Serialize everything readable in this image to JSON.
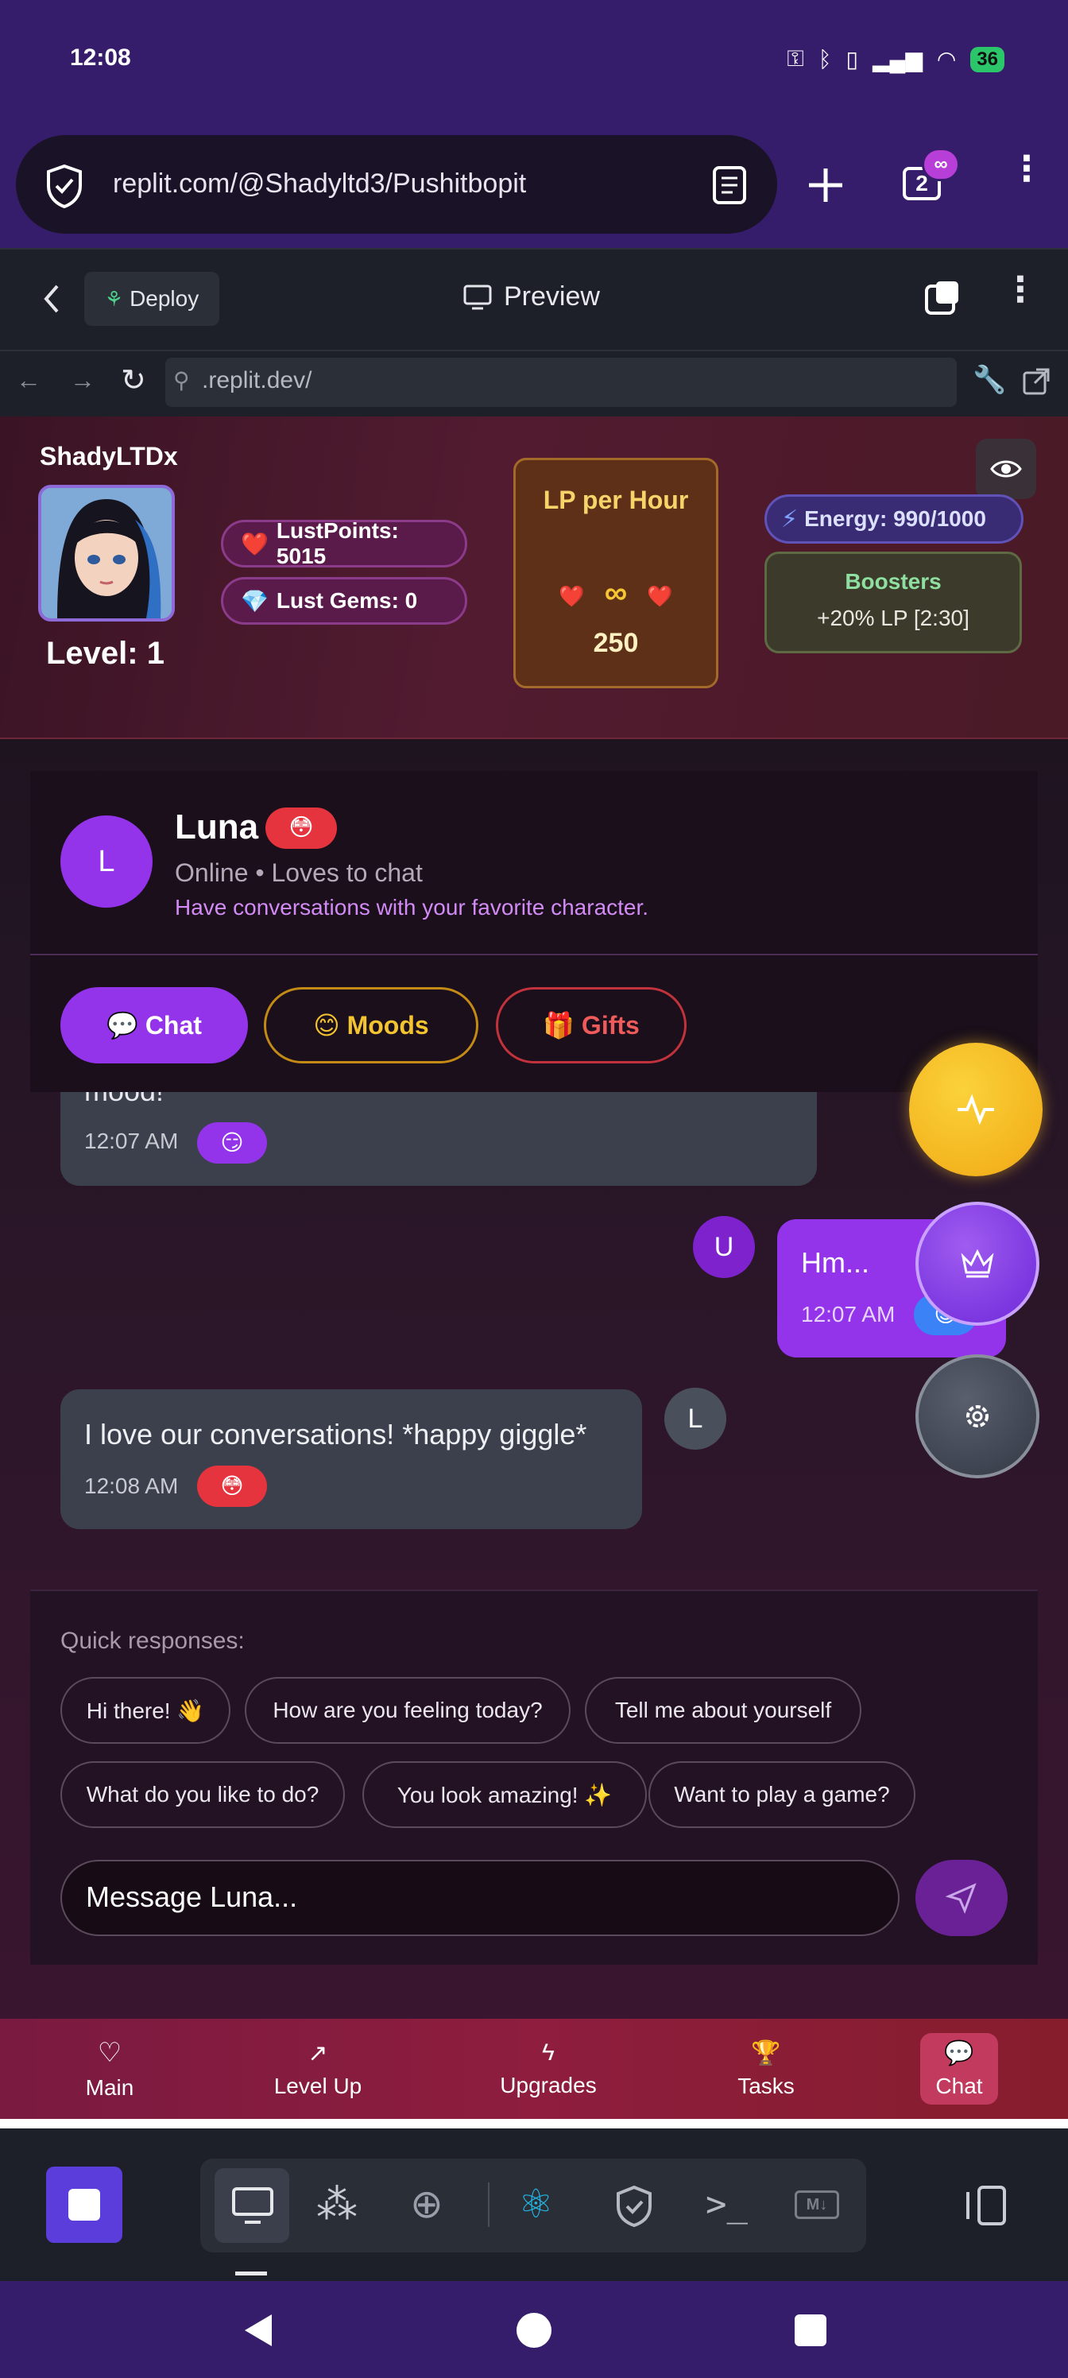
{
  "status_bar": {
    "time": "12:08",
    "battery": "36"
  },
  "browser": {
    "url": "replit.com/@Shadyltd3/Pushitbopit",
    "tab_count": "2",
    "tab_badge": "∞"
  },
  "replit": {
    "deploy_label": "Deploy",
    "preview_label": "Preview",
    "address": ".replit.dev/"
  },
  "player": {
    "username": "ShadyLTDx",
    "level": "Level: 1",
    "lust_points": "LustPoints: 5015",
    "lust_gems": "Lust Gems: 0",
    "lp_per_hour_title": "LP per Hour",
    "lp_per_hour_symbol": "∞",
    "lp_per_hour_value": "250",
    "energy": "Energy: 990/1000",
    "boosters_title": "Boosters",
    "boosters_value": "+20% LP [2:30]"
  },
  "character": {
    "avatar_letter": "L",
    "name": "Luna",
    "mood_emoji": "😳",
    "status": "Online • Loves to chat",
    "description": "Have conversations with your favorite character."
  },
  "tabs": [
    {
      "label": "💬 Chat"
    },
    {
      "label": "😊 Moods"
    },
    {
      "label": "🎁 Gifts"
    }
  ],
  "messages": [
    {
      "text_fragment": "mood!",
      "time": "12:07 AM",
      "mood": "😏"
    },
    {
      "sender_letter": "U",
      "text": "Hm...",
      "time": "12:07 AM",
      "mood": "😊"
    },
    {
      "sender_letter": "L",
      "text": "I love our conversations! *happy giggle*",
      "time": "12:08 AM",
      "mood": "😳"
    }
  ],
  "quick_responses": {
    "label": "Quick responses:",
    "items": [
      "Hi there! 👋",
      "How are you feeling today?",
      "Tell me about yourself",
      "What do you like to do?",
      "You look amazing! ✨",
      "Want to play a game?"
    ]
  },
  "composer": {
    "placeholder": "Message Luna..."
  },
  "bottom_nav": [
    "Main",
    "Level Up",
    "Upgrades",
    "Tasks",
    "Chat"
  ],
  "colors": {
    "accent": "#9333ea",
    "header_bg": "#361d6b",
    "nav_bg": "#8e1d3e"
  }
}
